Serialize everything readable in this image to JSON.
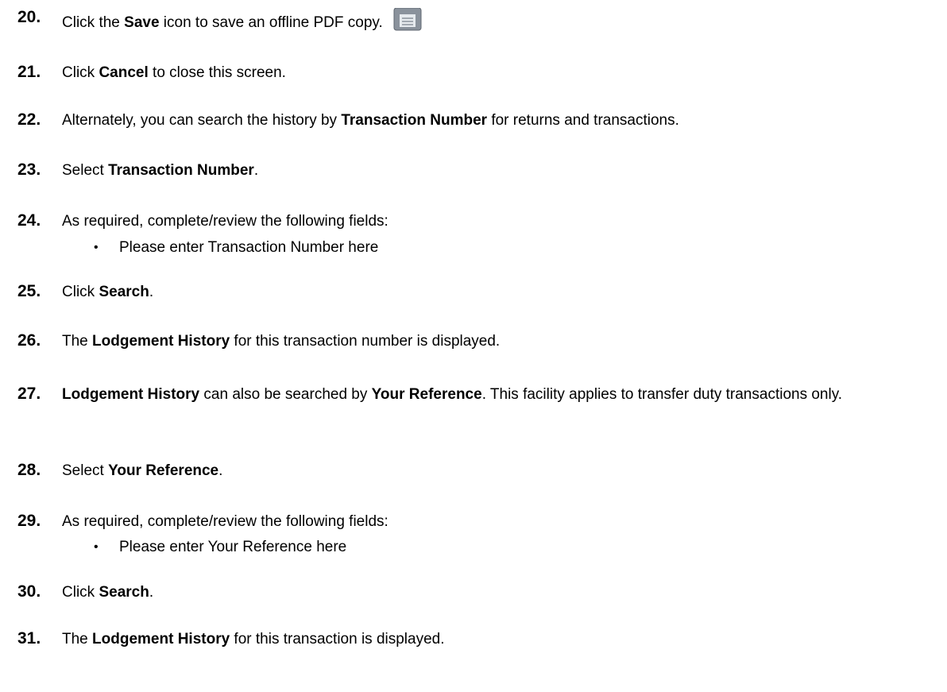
{
  "steps": [
    {
      "num": "20.",
      "parts": [
        {
          "t": "Click the "
        },
        {
          "t": "Save",
          "b": true
        },
        {
          "t": " icon to save an offline PDF copy."
        }
      ],
      "icon": "save-icon"
    },
    {
      "num": "21.",
      "parts": [
        {
          "t": "Click "
        },
        {
          "t": "Cancel",
          "b": true
        },
        {
          "t": " to close this screen."
        }
      ]
    },
    {
      "num": "22.",
      "parts": [
        {
          "t": "Alternately, you can search the history by "
        },
        {
          "t": "Transaction Number",
          "b": true
        },
        {
          "t": " for returns and transactions."
        }
      ]
    },
    {
      "num": "23.",
      "parts": [
        {
          "t": "Select "
        },
        {
          "t": "Transaction Number",
          "b": true
        },
        {
          "t": "."
        }
      ]
    },
    {
      "num": "24.",
      "parts": [
        {
          "t": "As required, complete/review the following fields:"
        }
      ]
    },
    {
      "num": "25.",
      "parts": [
        {
          "t": "Click "
        },
        {
          "t": "Search",
          "b": true
        },
        {
          "t": "."
        }
      ]
    },
    {
      "num": "26.",
      "parts": [
        {
          "t": "The "
        },
        {
          "t": "Lodgement History",
          "b": true
        },
        {
          "t": " for this transaction number is displayed."
        }
      ]
    },
    {
      "num": "27.",
      "parts": [
        {
          "t": "Lodgement History",
          "b": true
        },
        {
          "t": " can also be searched by "
        },
        {
          "t": "Your Reference",
          "b": true
        },
        {
          "t": ". This facility applies to transfer duty transactions only."
        }
      ]
    },
    {
      "num": "28.",
      "parts": [
        {
          "t": "Select "
        },
        {
          "t": "Your Reference",
          "b": true
        },
        {
          "t": "."
        }
      ]
    },
    {
      "num": "29.",
      "parts": [
        {
          "t": "As required, complete/review the following fields:"
        }
      ]
    },
    {
      "num": "30.",
      "parts": [
        {
          "t": "Click "
        },
        {
          "t": "Search",
          "b": true
        },
        {
          "t": "."
        }
      ]
    },
    {
      "num": "31.",
      "parts": [
        {
          "t": "The "
        },
        {
          "t": "Lodgement History",
          "b": true
        },
        {
          "t": " for this transaction is displayed."
        }
      ]
    }
  ],
  "bullets": [
    {
      "symbol": "•",
      "text": "Please enter Transaction Number here"
    },
    {
      "symbol": "•",
      "text": "Please enter Your Reference here"
    }
  ],
  "icon_colors": {
    "body": "#8a929c",
    "label": "#e6eaee",
    "outline": "#5f6770"
  }
}
